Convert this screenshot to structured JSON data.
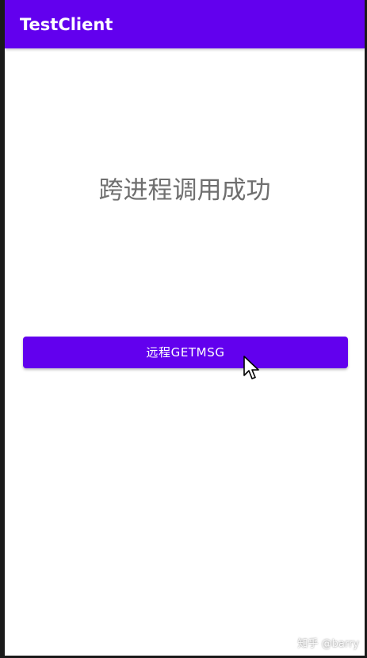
{
  "app_bar": {
    "title": "TestClient",
    "color": "#6200EE"
  },
  "main": {
    "message": "跨进程调用成功",
    "button_label": "远程GETMSG",
    "button_color": "#6200EE"
  },
  "overlay": {
    "cursor_icon": "arrow-cursor-icon",
    "watermark": "知乎 @barry"
  }
}
